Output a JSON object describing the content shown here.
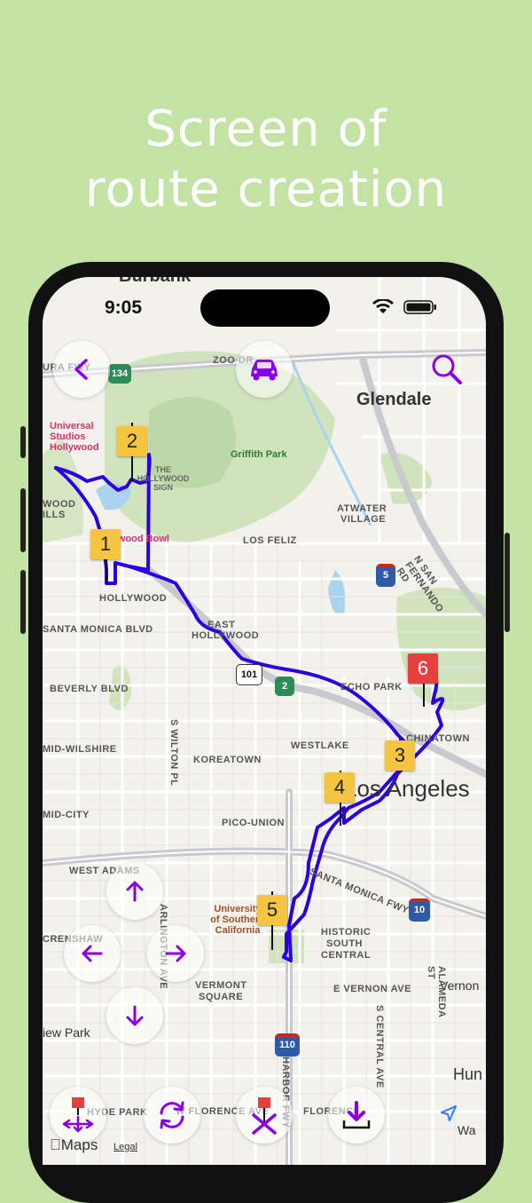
{
  "headline": {
    "line1": "Screen of",
    "line2": "route creation"
  },
  "status_bar": {
    "time": "9:05"
  },
  "map": {
    "labels": {
      "burbank": "Burbank",
      "glendale": "Glendale",
      "los_angeles": "Los Angeles",
      "griffith_park": "Griffith Park",
      "universal": [
        "Universal",
        "Studios",
        "Hollywood"
      ],
      "hollywood_sign": [
        "THE",
        "HOLLYWOOD",
        "SIGN"
      ],
      "hollywood_bowl": "Hollywood Bowl",
      "usc": [
        "University",
        "of Southern",
        "California"
      ],
      "los_feliz": "LOS FELIZ",
      "hollywood": "HOLLYWOOD",
      "east_hollywood": [
        "EAST",
        "HOLLYWOOD"
      ],
      "santa_monica_blvd": "SANTA MONICA BLVD",
      "beverly_blvd": "BEVERLY BLVD",
      "mid_wilshire": "MID-WILSHIRE",
      "koreatown": "KOREATOWN",
      "westlake": "WESTLAKE",
      "echo_park": "ECHO PARK",
      "chinatown": "CHINATOWN",
      "atwater_village": [
        "ATWATER",
        "VILLAGE"
      ],
      "pico_union": "PICO-UNION",
      "mid_city": "MID-CITY",
      "west_adams": "WEST ADAMS",
      "crenshaw": "CRENSHAW",
      "vermont_square": [
        "VERMONT",
        "SQUARE"
      ],
      "historic_south_central": [
        "HISTORIC",
        "SOUTH",
        "CENTRAL"
      ],
      "view_park": "iew Park",
      "hyde_park": "HYDE PARK",
      "florence_ave": "W FLORENCE AVE",
      "florence": "FLORENCE",
      "vernon": "Vernon",
      "e_vernon_ave": "E VERNON AVE",
      "huntington": "Hun",
      "walnut": "Wa",
      "zoo_dr": "ZOO DR",
      "ventura_fwy": "URA FWY",
      "santa_monica_fwy": "SANTA MONICA FWY",
      "harbor_fwy": "HARBOR FWY",
      "s_wilton_pl": "S WILTON PL",
      "arlington_ave": "ARLINGTON AVE",
      "s_central_ave": "S CENTRAL AVE",
      "alameda_st": "ALAMEDA ST",
      "n_san_fernando_rd": "N SAN FERNANDO RD",
      "wood": "WOOD",
      "ills": "ILLS"
    },
    "shields": {
      "sr134": "134",
      "i5": "5",
      "us101": "101",
      "sr2": "2",
      "i10": "10",
      "i110": "110"
    },
    "attribution": {
      "maps": "Maps",
      "legal": "Legal"
    }
  },
  "waypoints": [
    {
      "label": "1",
      "color": "#f5c542"
    },
    {
      "label": "2",
      "color": "#f5c542"
    },
    {
      "label": "3",
      "color": "#f5c542"
    },
    {
      "label": "4",
      "color": "#f5c542"
    },
    {
      "label": "5",
      "color": "#f5c542"
    },
    {
      "label": "6",
      "color": "#e5403c"
    }
  ],
  "controls": {
    "back": "chevron-left-icon",
    "car": "car-icon",
    "search": "magnifier-icon",
    "pan": [
      "arrow-up-icon",
      "arrow-left-icon",
      "arrow-right-icon",
      "arrow-down-icon"
    ],
    "bottom": [
      "move-point-icon",
      "reverse-route-icon",
      "delete-point-icon",
      "download-icon",
      "location-arrow-icon"
    ]
  },
  "colors": {
    "route": "#2a00e0",
    "accent": "#8a00e6",
    "background": "#c3e2a3"
  }
}
